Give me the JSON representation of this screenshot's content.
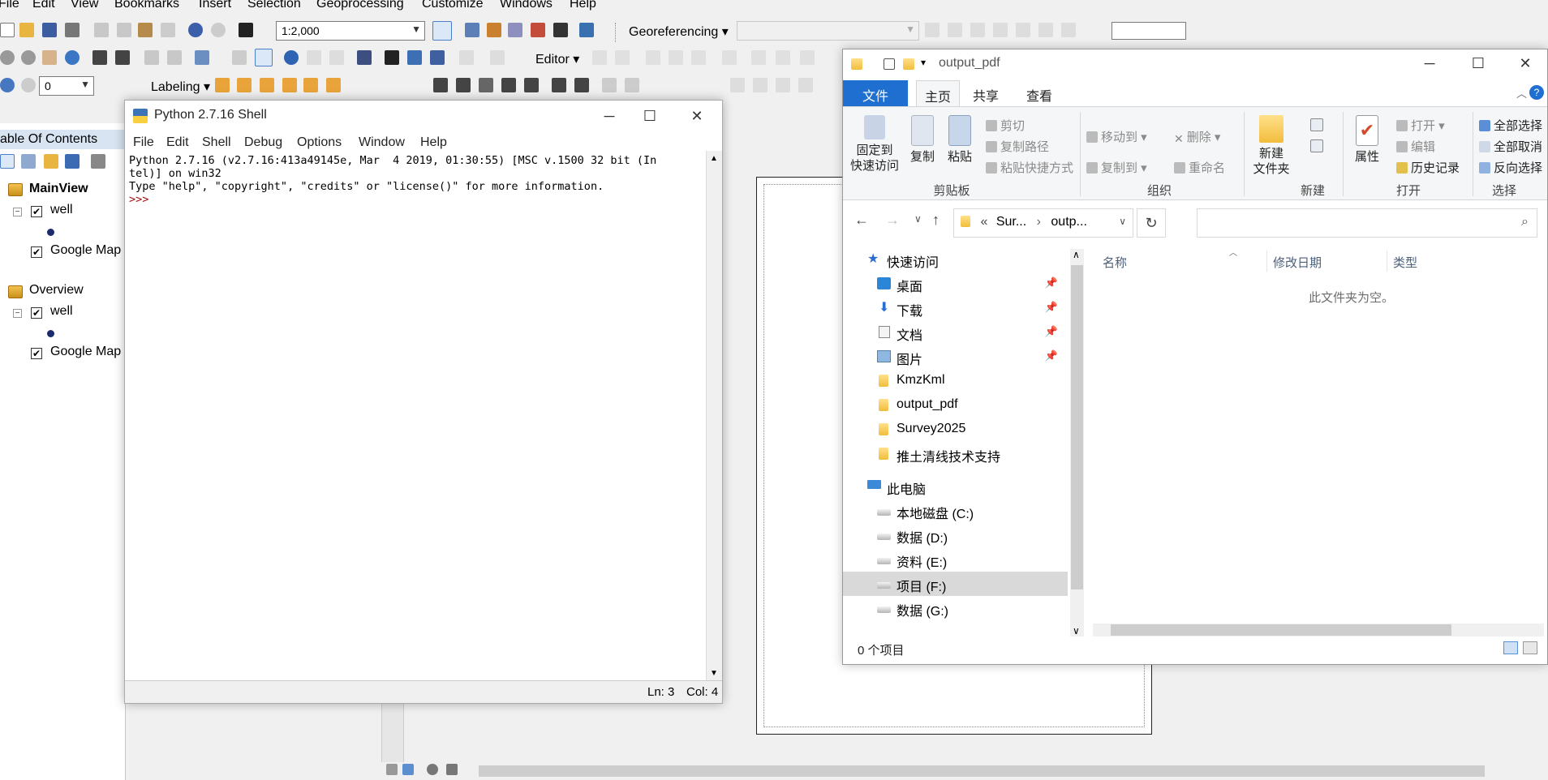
{
  "arcmap": {
    "menu": [
      "File",
      "Edit",
      "View",
      "Bookmarks",
      "Insert",
      "Selection",
      "Geoprocessing",
      "Customize",
      "Windows",
      "Help"
    ],
    "scale": "1:2,000",
    "georeferencing_label": "Georeferencing",
    "editor_label": "Editor",
    "labeling_label": "Labeling",
    "layer_combo_value": "0",
    "toc": {
      "title": "able Of Contents",
      "frames": [
        {
          "name": "MainView",
          "layers": [
            {
              "name": "well",
              "checked": true
            },
            {
              "name": "Google Map",
              "checked": true
            }
          ]
        },
        {
          "name": "Overview",
          "layers": [
            {
              "name": "well",
              "checked": true
            },
            {
              "name": "Google Map",
              "checked": true
            }
          ]
        }
      ]
    }
  },
  "pyshell": {
    "title": "Python 2.7.16 Shell",
    "menu": [
      "File",
      "Edit",
      "Shell",
      "Debug",
      "Options",
      "Window",
      "Help"
    ],
    "console_line1": "Python 2.7.16 (v2.7.16:413a49145e, Mar  4 2019, 01:30:55) [MSC v.1500 32 bit (In",
    "console_line2": "tel)] on win32",
    "console_line3": "Type \"help\", \"copyright\", \"credits\" or \"license()\" for more information.",
    "prompt": ">>> ",
    "status_ln": "Ln: 3",
    "status_col": "Col: 4"
  },
  "explorer": {
    "title": "output_pdf",
    "tabs": {
      "file": "文件",
      "home": "主页",
      "share": "共享",
      "view": "查看"
    },
    "ribbon": {
      "pin_quick_access": "固定到\n快速访问",
      "copy": "复制",
      "paste": "粘贴",
      "cut": "剪切",
      "copy_path": "复制路径",
      "paste_shortcut": "粘贴快捷方式",
      "group_clipboard": "剪贴板",
      "move_to": "移动到",
      "copy_to": "复制到",
      "delete": "删除",
      "rename": "重命名",
      "group_organize": "组织",
      "new_folder": "新建\n文件夹",
      "group_new": "新建",
      "properties": "属性",
      "open": "打开",
      "edit": "编辑",
      "history": "历史记录",
      "group_open": "打开",
      "select_all": "全部选择",
      "select_none": "全部取消",
      "invert_selection": "反向选择",
      "group_select": "选择"
    },
    "address": {
      "part1": "Sur...",
      "part2": "outp..."
    },
    "nav": [
      {
        "label": "快速访问",
        "kind": "star"
      },
      {
        "label": "桌面",
        "kind": "desktop",
        "pinned": true
      },
      {
        "label": "下载",
        "kind": "download",
        "pinned": true
      },
      {
        "label": "文档",
        "kind": "doc",
        "pinned": true
      },
      {
        "label": "图片",
        "kind": "pic",
        "pinned": true
      },
      {
        "label": "KmzKml",
        "kind": "folder"
      },
      {
        "label": "output_pdf",
        "kind": "folder"
      },
      {
        "label": "Survey2025",
        "kind": "folder"
      },
      {
        "label": "推土清线技术支持",
        "kind": "folder"
      },
      {
        "label": "此电脑",
        "kind": "pc"
      },
      {
        "label": "本地磁盘 (C:)",
        "kind": "drive"
      },
      {
        "label": "数据 (D:)",
        "kind": "drive"
      },
      {
        "label": "资料 (E:)",
        "kind": "drive"
      },
      {
        "label": "项目 (F:)",
        "kind": "drive",
        "selected": true
      },
      {
        "label": "数据 (G:)",
        "kind": "drive"
      }
    ],
    "columns": {
      "name": "名称",
      "modified": "修改日期",
      "type": "类型"
    },
    "empty_message": "此文件夹为空。",
    "status": "0 个项目"
  }
}
